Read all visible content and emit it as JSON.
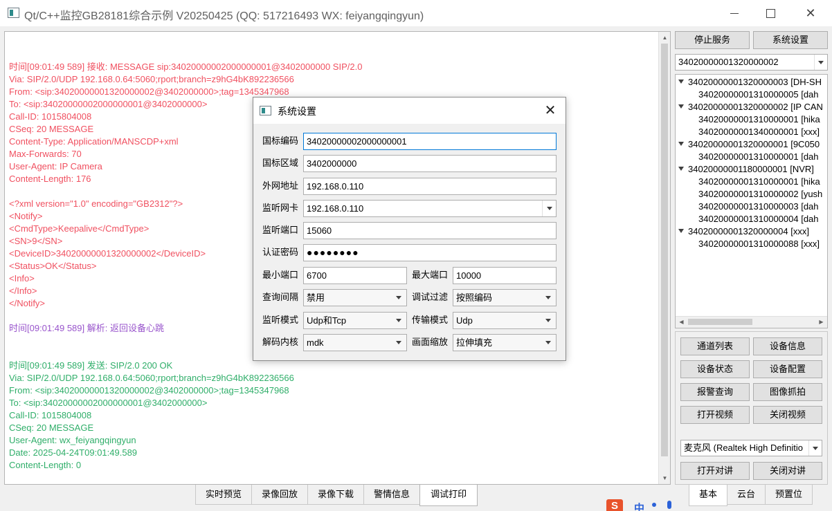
{
  "window": {
    "title": "Qt/C++监控GB28181综合示例 V20250425 (QQ: 517216493 WX: feiyangqingyun)",
    "minimize_glyph": "",
    "maximize_glyph": "",
    "close_glyph": "✕"
  },
  "log": {
    "lines": [
      {
        "text": "",
        "type": "blank"
      },
      {
        "text": "时间[09:01:49 589] 接收: MESSAGE sip:34020000002000000001@3402000000 SIP/2.0",
        "type": "recv"
      },
      {
        "text": "Via: SIP/2.0/UDP 192.168.0.64:5060;rport;branch=z9hG4bK892236566",
        "type": "recv"
      },
      {
        "text": "From: <sip:34020000001320000002@3402000000>;tag=1345347968",
        "type": "recv"
      },
      {
        "text": "To: <sip:34020000002000000001@3402000000>",
        "type": "recv"
      },
      {
        "text": "Call-ID: 1015804008",
        "type": "recv"
      },
      {
        "text": "CSeq: 20 MESSAGE",
        "type": "recv"
      },
      {
        "text": "Content-Type: Application/MANSCDP+xml",
        "type": "recv"
      },
      {
        "text": "Max-Forwards: 70",
        "type": "recv"
      },
      {
        "text": "User-Agent: IP Camera",
        "type": "recv"
      },
      {
        "text": "Content-Length:   176",
        "type": "recv"
      },
      {
        "text": "",
        "type": "blank"
      },
      {
        "text": "<?xml version=\"1.0\" encoding=\"GB2312\"?>",
        "type": "recv"
      },
      {
        "text": "<Notify>",
        "type": "recv"
      },
      {
        "text": "<CmdType>Keepalive</CmdType>",
        "type": "recv"
      },
      {
        "text": "<SN>9</SN>",
        "type": "recv"
      },
      {
        "text": "<DeviceID>34020000001320000002</DeviceID>",
        "type": "recv"
      },
      {
        "text": "<Status>OK</Status>",
        "type": "recv"
      },
      {
        "text": "<Info>",
        "type": "recv"
      },
      {
        "text": "</Info>",
        "type": "recv"
      },
      {
        "text": "</Notify>",
        "type": "recv"
      },
      {
        "text": "",
        "type": "blank"
      },
      {
        "text": "时间[09:01:49 589] 解析: 返回设备心跳",
        "type": "parse"
      },
      {
        "text": "",
        "type": "blank"
      },
      {
        "text": "",
        "type": "blank"
      },
      {
        "text": "时间[09:01:49 589] 发送: SIP/2.0 200 OK",
        "type": "send"
      },
      {
        "text": "Via: SIP/2.0/UDP 192.168.0.64:5060;rport;branch=z9hG4bK892236566",
        "type": "send"
      },
      {
        "text": "From: <sip:34020000001320000002@3402000000>;tag=1345347968",
        "type": "send"
      },
      {
        "text": "To: <sip:34020000002000000001@3402000000>",
        "type": "send"
      },
      {
        "text": "Call-ID: 1015804008",
        "type": "send"
      },
      {
        "text": "CSeq: 20 MESSAGE",
        "type": "send"
      },
      {
        "text": "User-Agent: wx_feiyangqingyun",
        "type": "send"
      },
      {
        "text": "Date: 2025-04-24T09:01:49.589",
        "type": "send"
      },
      {
        "text": "Content-Length: 0",
        "type": "send"
      }
    ]
  },
  "bottom_tabs": [
    "实时预览",
    "录像回放",
    "录像下载",
    "警情信息",
    "调试打印"
  ],
  "bottom_tab_active": 4,
  "right": {
    "stop_service": "停止服务",
    "system_settings": "系统设置",
    "device_select": "34020000001320000002",
    "tree": [
      {
        "text": "34020000001320000003 [DH-SH",
        "level": 0
      },
      {
        "text": "34020000001310000005 [dah",
        "level": 1
      },
      {
        "text": "34020000001320000002 [IP CAN",
        "level": 0
      },
      {
        "text": "34020000001310000001 [hika",
        "level": 1
      },
      {
        "text": "34020000001340000001 [xxx]",
        "level": 1
      },
      {
        "text": "34020000001320000001 [9C050",
        "level": 0
      },
      {
        "text": "34020000001310000001 [dah",
        "level": 1
      },
      {
        "text": "34020000001180000001 [NVR]",
        "level": 0
      },
      {
        "text": "34020000001310000001 [hika",
        "level": 1
      },
      {
        "text": "34020000001310000002 [yush",
        "level": 1
      },
      {
        "text": "34020000001310000003 [dah",
        "level": 1
      },
      {
        "text": "34020000001310000004 [dah",
        "level": 1
      },
      {
        "text": "34020000001320000004 [xxx]",
        "level": 0
      },
      {
        "text": "34020000001310000088 [xxx]",
        "level": 1
      }
    ],
    "buttons": {
      "channel_list": "通道列表",
      "device_info": "设备信息",
      "device_status": "设备状态",
      "device_config": "设备配置",
      "alarm_query": "报警查询",
      "image_capture": "图像抓拍",
      "open_video": "打开视频",
      "close_video": "关闭视频",
      "open_talk": "打开对讲",
      "close_talk": "关闭对讲"
    },
    "mic_select": "麦克风 (Realtek High Definitio",
    "tabs": [
      "基本",
      "云台",
      "预置位"
    ],
    "tab_active": 0
  },
  "dialog": {
    "title": "系统设置",
    "close_glyph": "✕",
    "gb_code_label": "国标编码",
    "gb_code": "34020000002000000001",
    "gb_region_label": "国标区域",
    "gb_region": "3402000000",
    "wan_addr_label": "外网地址",
    "wan_addr": "192.168.0.110",
    "nic_label": "监听网卡",
    "nic": "192.168.0.110",
    "port_label": "监听端口",
    "port": "15060",
    "auth_pwd_label": "认证密码",
    "auth_pwd_masked": "●●●●●●●●",
    "min_port_label": "最小端口",
    "min_port": "6700",
    "max_port_label": "最大端口",
    "max_port": "10000",
    "query_interval_label": "查询间隔",
    "query_interval": "禁用",
    "debug_filter_label": "调试过滤",
    "debug_filter": "按照编码",
    "listen_mode_label": "监听模式",
    "listen_mode": "Udp和Tcp",
    "transport_mode_label": "传输模式",
    "transport_mode": "Udp",
    "decoder_label": "解码内核",
    "decoder": "mdk",
    "scale_label": "画面缩放",
    "scale": "拉伸填充"
  },
  "tray": {
    "sogou_glyph": "S",
    "ime_glyph": "中"
  }
}
